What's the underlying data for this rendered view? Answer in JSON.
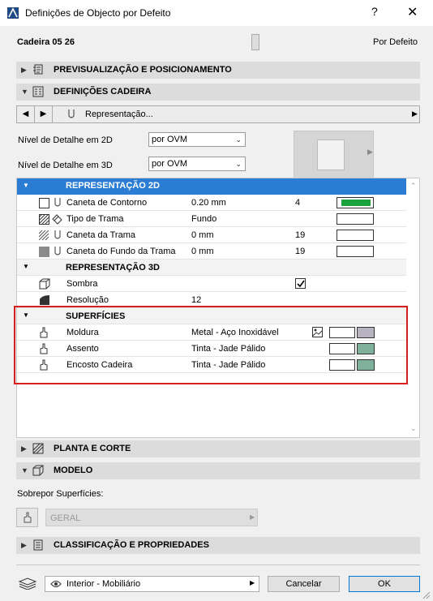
{
  "window": {
    "title": "Definições de Objecto por Defeito",
    "help": "?",
    "close": "✕"
  },
  "header": {
    "object_name": "Cadeira 05 26",
    "default_label": "Por Defeito"
  },
  "sections": {
    "preview": "PREVISUALIZAÇÃO E POSICIONAMENTO",
    "settings": "DEFINIÇÕES CADEIRA",
    "plan": "PLANTA E CORTE",
    "model": "MODELO",
    "classification": "CLASSIFICAÇÃO E PROPRIEDADES"
  },
  "nav": {
    "page_label": "Representação..."
  },
  "detail": {
    "level_2d_label": "Nível de Detalhe em 2D",
    "level_2d_value": "por OVM",
    "level_3d_label": "Nível de Detalhe em 3D",
    "level_3d_value": "por OVM"
  },
  "params": {
    "rep2d": {
      "title": "REPRESENTAÇÃO 2D",
      "rows": [
        {
          "label": "Caneta de Contorno",
          "value": "0.20 mm",
          "num": "4"
        },
        {
          "label": "Tipo de Trama",
          "value": "Fundo",
          "num": ""
        },
        {
          "label": "Caneta da Trama",
          "value": "0 mm",
          "num": "19"
        },
        {
          "label": "Caneta do Fundo da Trama",
          "value": "0 mm",
          "num": "19"
        }
      ]
    },
    "rep3d": {
      "title": "REPRESENTAÇÃO 3D",
      "rows": [
        {
          "label": "Sombra",
          "value": "",
          "checked": true
        },
        {
          "label": "Resolução",
          "value": "12"
        }
      ]
    },
    "surfaces": {
      "title": "SUPERFÍCIES",
      "rows": [
        {
          "label": "Moldura",
          "value": "Metal - Aço Inoxidável",
          "color": "#b7b3c0"
        },
        {
          "label": "Assento",
          "value": "Tinta - Jade Pálido",
          "color": "#7fb09c"
        },
        {
          "label": "Encosto Cadeira",
          "value": "Tinta - Jade Pálido",
          "color": "#7fb09c"
        }
      ]
    }
  },
  "model": {
    "override_label": "Sobrepor Superfícies:",
    "override_value": "GERAL"
  },
  "footer": {
    "layer": "Interior - Mobiliário",
    "cancel": "Cancelar",
    "ok": "OK"
  },
  "colors": {
    "selection": "#2b7cd3",
    "highlight_border": "#d81e1e",
    "pen_green": "#1aa33a"
  }
}
